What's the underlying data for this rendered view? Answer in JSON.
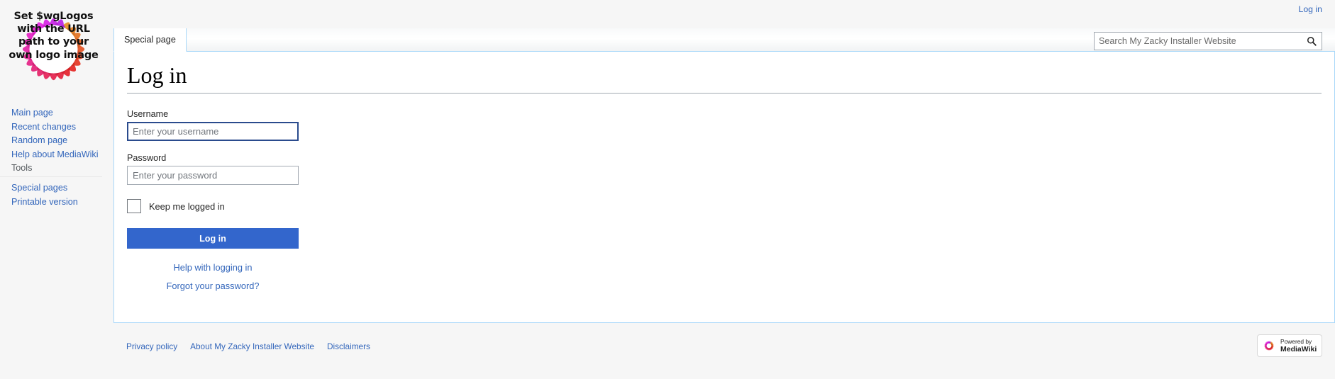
{
  "logo": {
    "alt": "placeholder-logo",
    "text": "Set $wgLogos with the URL path to your own logo image"
  },
  "sidebar": {
    "navigation": [
      {
        "label": "Main page"
      },
      {
        "label": "Recent changes"
      },
      {
        "label": "Random page"
      },
      {
        "label": "Help about MediaWiki"
      }
    ],
    "tools_heading": "Tools",
    "tools": [
      {
        "label": "Special pages"
      },
      {
        "label": "Printable version"
      }
    ]
  },
  "header": {
    "personal_login": "Log in",
    "tab_label": "Special page"
  },
  "search": {
    "placeholder": "Search My Zacky Installer Website",
    "value": "",
    "icon": "search-icon"
  },
  "main": {
    "title": "Log in",
    "username_label": "Username",
    "username_placeholder": "Enter your username",
    "username_value": "",
    "password_label": "Password",
    "password_placeholder": "Enter your password",
    "password_value": "",
    "keep_logged_in_label": "Keep me logged in",
    "keep_logged_in_checked": false,
    "submit_label": "Log in",
    "help_link": "Help with logging in",
    "forgot_link": "Forgot your password?"
  },
  "footer": {
    "links": [
      {
        "label": "Privacy policy"
      },
      {
        "label": "About My Zacky Installer Website"
      },
      {
        "label": "Disclaimers"
      }
    ],
    "powered_by_line1": "Powered by",
    "powered_by_line2": "MediaWiki"
  },
  "colors": {
    "link": "#3366bb",
    "button": "#3366cc",
    "focus_border": "#2a4b8d",
    "panel_border": "#a7d7f9"
  }
}
